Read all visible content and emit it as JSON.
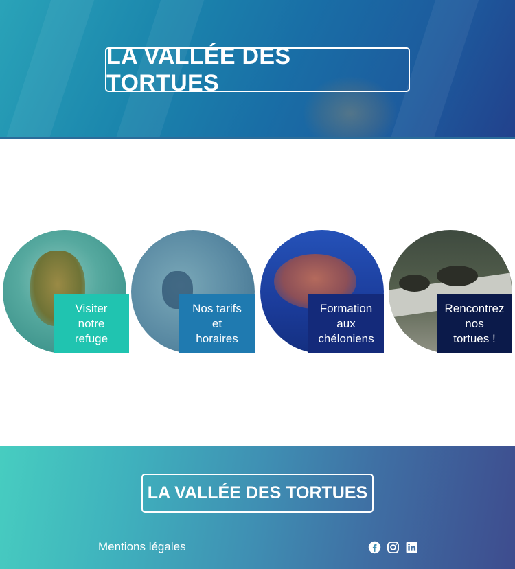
{
  "header": {
    "title": "LA VALLÉE DES TORTUES"
  },
  "cards": [
    {
      "lines": [
        "Visiter",
        "notre",
        "refuge"
      ]
    },
    {
      "lines": [
        "Nos tarifs",
        "et",
        "horaires"
      ]
    },
    {
      "lines": [
        "Formation",
        "aux",
        "chéloniens"
      ]
    },
    {
      "lines": [
        "Rencontrez",
        "nos",
        "tortues !"
      ]
    }
  ],
  "footer": {
    "title": "LA VALLÉE DES TORTUES",
    "legal_link": "Mentions légales",
    "socials": [
      "facebook-icon",
      "instagram-icon",
      "linkedin-icon"
    ]
  }
}
